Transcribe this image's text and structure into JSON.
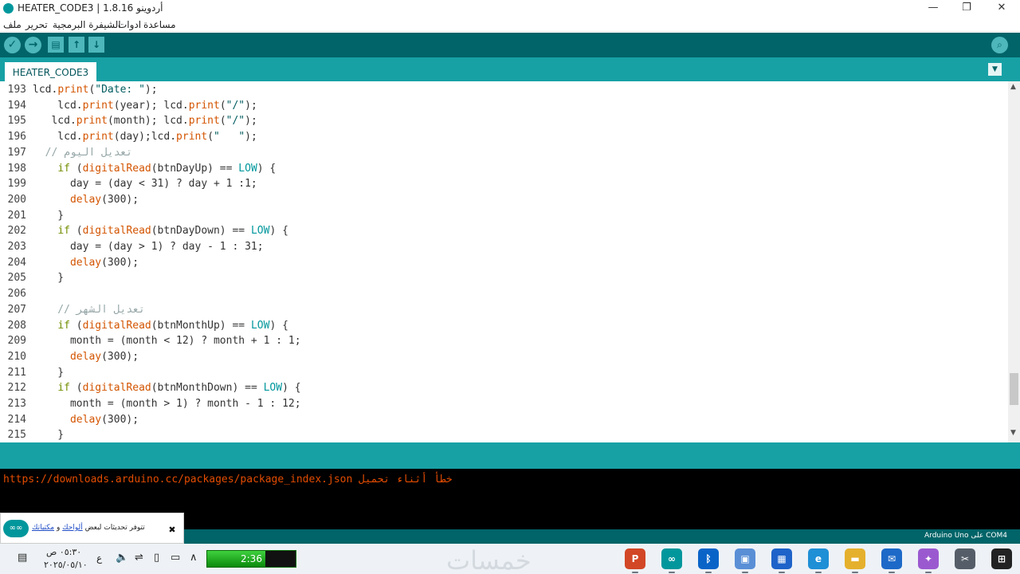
{
  "window": {
    "title": "HEATER_CODE3 | أردوينو 1.8.16",
    "minimize": "—",
    "maximize": "❐",
    "close": "✕"
  },
  "menu": [
    "ملف",
    "تحرير",
    "الشيفرة البرمجية",
    "ادوات",
    "مساعدة"
  ],
  "toolbar": {
    "verify_icon": "✓",
    "upload_icon": "→",
    "new_icon": "▤",
    "open_icon": "↑",
    "save_icon": "↓",
    "serial_icon": "⌕"
  },
  "tab": {
    "label": "HEATER_CODE3",
    "menu_icon": "▼"
  },
  "code_lines": [
    {
      "n": "193",
      "segs": [
        [
          "",
          "lcd."
        ],
        [
          "f",
          "print"
        ],
        [
          "",
          "("
        ],
        [
          "s",
          "\"Date: \""
        ],
        [
          "",
          ");"
        ]
      ]
    },
    {
      "n": "194",
      "segs": [
        [
          "",
          "    lcd."
        ],
        [
          "f",
          "print"
        ],
        [
          "",
          "(year); lcd."
        ],
        [
          "f",
          "print"
        ],
        [
          "",
          "("
        ],
        [
          "s",
          "\"/\""
        ],
        [
          "",
          ");"
        ]
      ]
    },
    {
      "n": "195",
      "segs": [
        [
          "",
          "   lcd."
        ],
        [
          "f",
          "print"
        ],
        [
          "",
          "(month); lcd."
        ],
        [
          "f",
          "print"
        ],
        [
          "",
          "("
        ],
        [
          "s",
          "\"/\""
        ],
        [
          "",
          ");"
        ]
      ]
    },
    {
      "n": "196",
      "segs": [
        [
          "",
          "    lcd."
        ],
        [
          "f",
          "print"
        ],
        [
          "",
          "(day);lcd."
        ],
        [
          "f",
          "print"
        ],
        [
          "",
          "("
        ],
        [
          "s",
          "\"   \""
        ],
        [
          "",
          ");"
        ]
      ]
    },
    {
      "n": "197",
      "segs": [
        [
          "cm",
          "  // تعديل اليوم"
        ]
      ]
    },
    {
      "n": "198",
      "segs": [
        [
          "",
          "    "
        ],
        [
          "k",
          "if"
        ],
        [
          "",
          " ("
        ],
        [
          "f",
          "digitalRead"
        ],
        [
          "",
          "(btnDayUp) == "
        ],
        [
          "c",
          "LOW"
        ],
        [
          "",
          ") {"
        ]
      ]
    },
    {
      "n": "199",
      "segs": [
        [
          "",
          "      day = (day < 31) ? day + 1 :1;"
        ]
      ]
    },
    {
      "n": "200",
      "segs": [
        [
          "",
          "      "
        ],
        [
          "f",
          "delay"
        ],
        [
          "",
          "(300);"
        ]
      ]
    },
    {
      "n": "201",
      "segs": [
        [
          "",
          "    }"
        ]
      ]
    },
    {
      "n": "202",
      "segs": [
        [
          "",
          "    "
        ],
        [
          "k",
          "if"
        ],
        [
          "",
          " ("
        ],
        [
          "f",
          "digitalRead"
        ],
        [
          "",
          "(btnDayDown) == "
        ],
        [
          "c",
          "LOW"
        ],
        [
          "",
          ") {"
        ]
      ]
    },
    {
      "n": "203",
      "segs": [
        [
          "",
          "      day = (day > 1) ? day - 1 : 31;"
        ]
      ]
    },
    {
      "n": "204",
      "segs": [
        [
          "",
          "      "
        ],
        [
          "f",
          "delay"
        ],
        [
          "",
          "(300);"
        ]
      ]
    },
    {
      "n": "205",
      "segs": [
        [
          "",
          "    }"
        ]
      ]
    },
    {
      "n": "206",
      "segs": [
        [
          "",
          ""
        ]
      ]
    },
    {
      "n": "207",
      "segs": [
        [
          "cm",
          "    // تعديل الشهر"
        ]
      ]
    },
    {
      "n": "208",
      "segs": [
        [
          "",
          "    "
        ],
        [
          "k",
          "if"
        ],
        [
          "",
          " ("
        ],
        [
          "f",
          "digitalRead"
        ],
        [
          "",
          "(btnMonthUp) == "
        ],
        [
          "c",
          "LOW"
        ],
        [
          "",
          ") {"
        ]
      ]
    },
    {
      "n": "209",
      "segs": [
        [
          "",
          "      month = (month < 12) ? month + 1 : 1;"
        ]
      ]
    },
    {
      "n": "210",
      "segs": [
        [
          "",
          "      "
        ],
        [
          "f",
          "delay"
        ],
        [
          "",
          "(300);"
        ]
      ]
    },
    {
      "n": "211",
      "segs": [
        [
          "",
          "    }"
        ]
      ]
    },
    {
      "n": "212",
      "segs": [
        [
          "",
          "    "
        ],
        [
          "k",
          "if"
        ],
        [
          "",
          " ("
        ],
        [
          "f",
          "digitalRead"
        ],
        [
          "",
          "(btnMonthDown) == "
        ],
        [
          "c",
          "LOW"
        ],
        [
          "",
          ") {"
        ]
      ]
    },
    {
      "n": "213",
      "segs": [
        [
          "",
          "      month = (month > 1) ? month - 1 : 12;"
        ]
      ]
    },
    {
      "n": "214",
      "segs": [
        [
          "",
          "      "
        ],
        [
          "f",
          "delay"
        ],
        [
          "",
          "(300);"
        ]
      ]
    },
    {
      "n": "215",
      "segs": [
        [
          "",
          "    }"
        ]
      ]
    }
  ],
  "console": {
    "error": "خطأ أثناء تحميل https://downloads.arduino.cc/packages/package_index.json"
  },
  "footer": {
    "board": "Arduino Uno على COM4"
  },
  "notification": {
    "text": "تتوفر تحديثات لبعض",
    "link1": "ألواحك",
    "conj": " و",
    "link2": "مكتباتك",
    "close_icon": "✖",
    "logo_icon": "∞∞"
  },
  "taskbar": {
    "time": "٠٥:٣٠ ص",
    "date": "٢٠٢٥/٠٥/١٠",
    "ime": "ع",
    "progress_label": "2:36",
    "progress_fraction": 0.66,
    "watermark": "خمسات",
    "apps": [
      {
        "name": "powerpoint",
        "icon": "P",
        "color": "#d24726"
      },
      {
        "name": "arduino",
        "icon": "∞",
        "color": "#00979c"
      },
      {
        "name": "bluetooth",
        "icon": "ᛒ",
        "color": "#0a64c8"
      },
      {
        "name": "photos",
        "icon": "▣",
        "color": "#5a8fd6"
      },
      {
        "name": "store",
        "icon": "▦",
        "color": "#1e63c9"
      },
      {
        "name": "edge",
        "icon": "e",
        "color": "#1f8fd6"
      },
      {
        "name": "explorer",
        "icon": "▬",
        "color": "#e5b02c"
      },
      {
        "name": "mail",
        "icon": "✉",
        "color": "#1d69c8"
      },
      {
        "name": "copilot",
        "icon": "✦",
        "color": "#9b59d0"
      },
      {
        "name": "snip",
        "icon": "✂",
        "color": "#555e68"
      },
      {
        "name": "start",
        "icon": "⊞",
        "color": "#222"
      }
    ]
  }
}
